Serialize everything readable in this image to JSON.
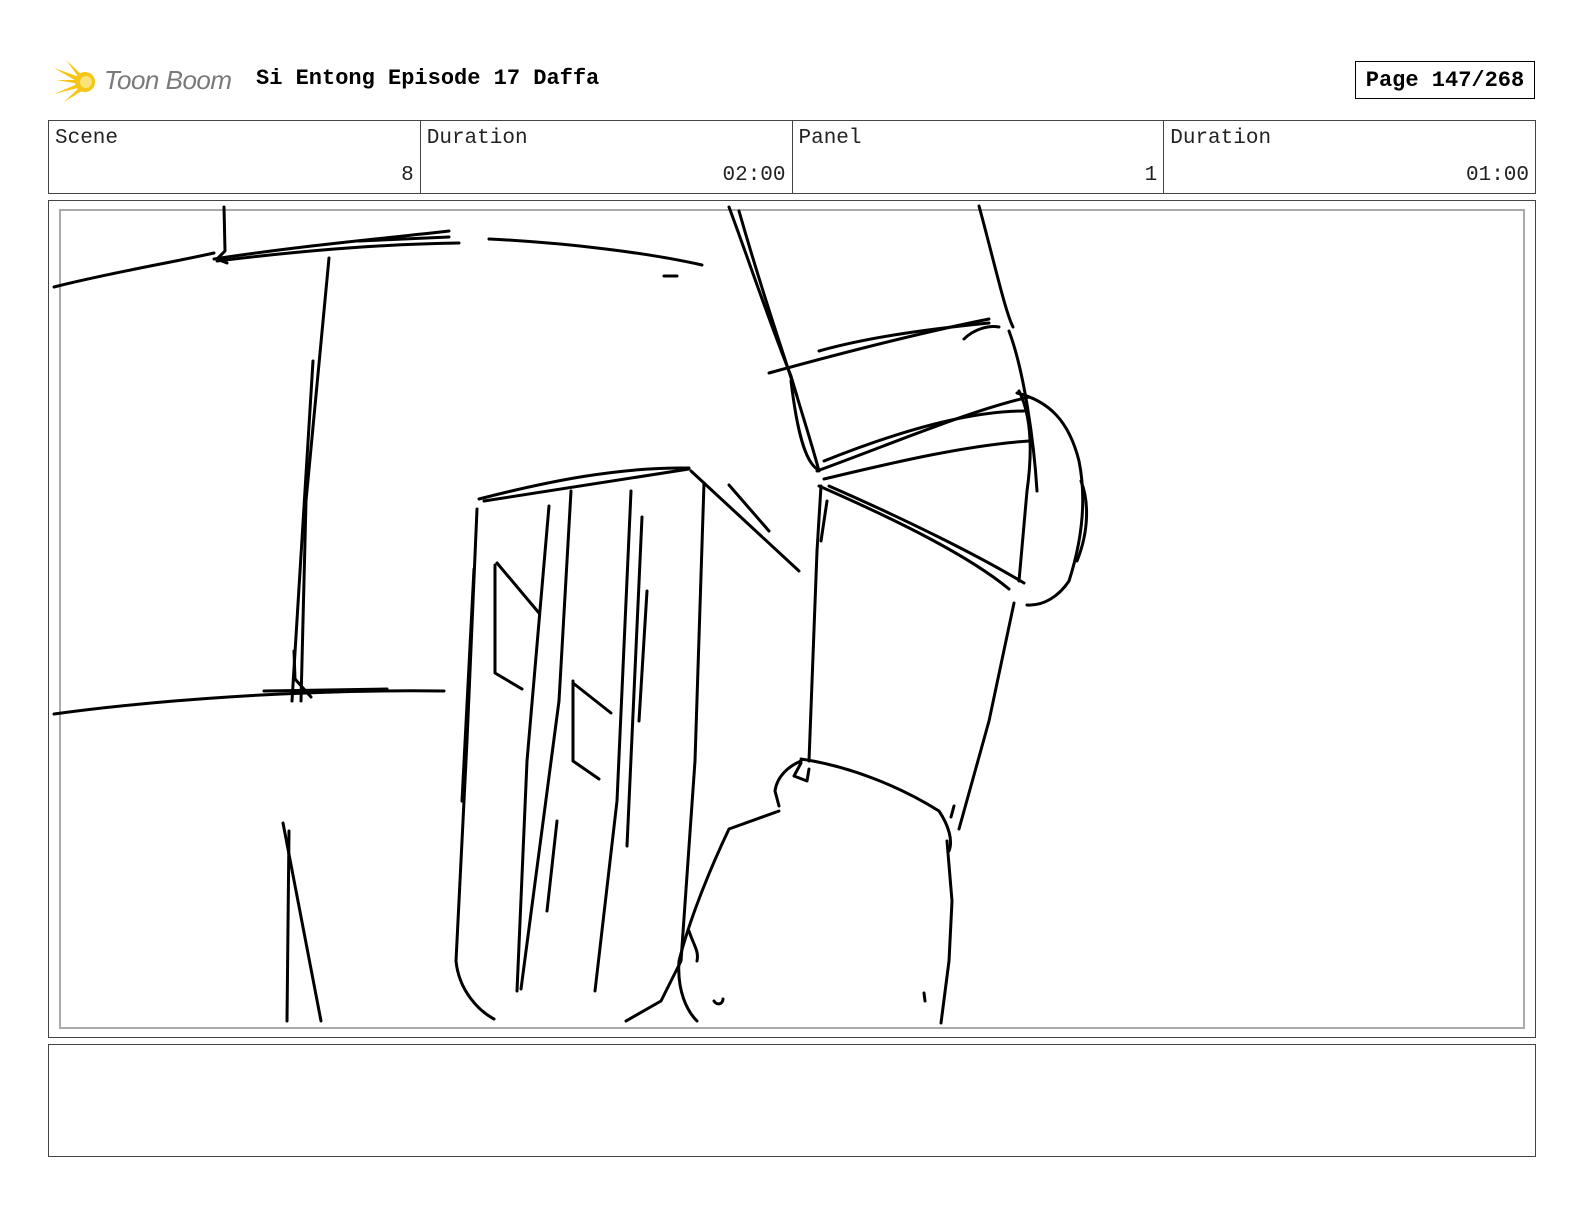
{
  "header": {
    "logo_text": "Toon Boom",
    "title": "Si Entong Episode 17 Daffa",
    "page_label": "Page 147/268"
  },
  "info": [
    {
      "label": "Scene",
      "value": "8"
    },
    {
      "label": "Duration",
      "value": "02:00"
    },
    {
      "label": "Panel",
      "value": "1"
    },
    {
      "label": "Duration",
      "value": "01:00"
    }
  ],
  "panel": {
    "icon": "rough-pencil-sketch"
  },
  "notes": {
    "text": ""
  }
}
